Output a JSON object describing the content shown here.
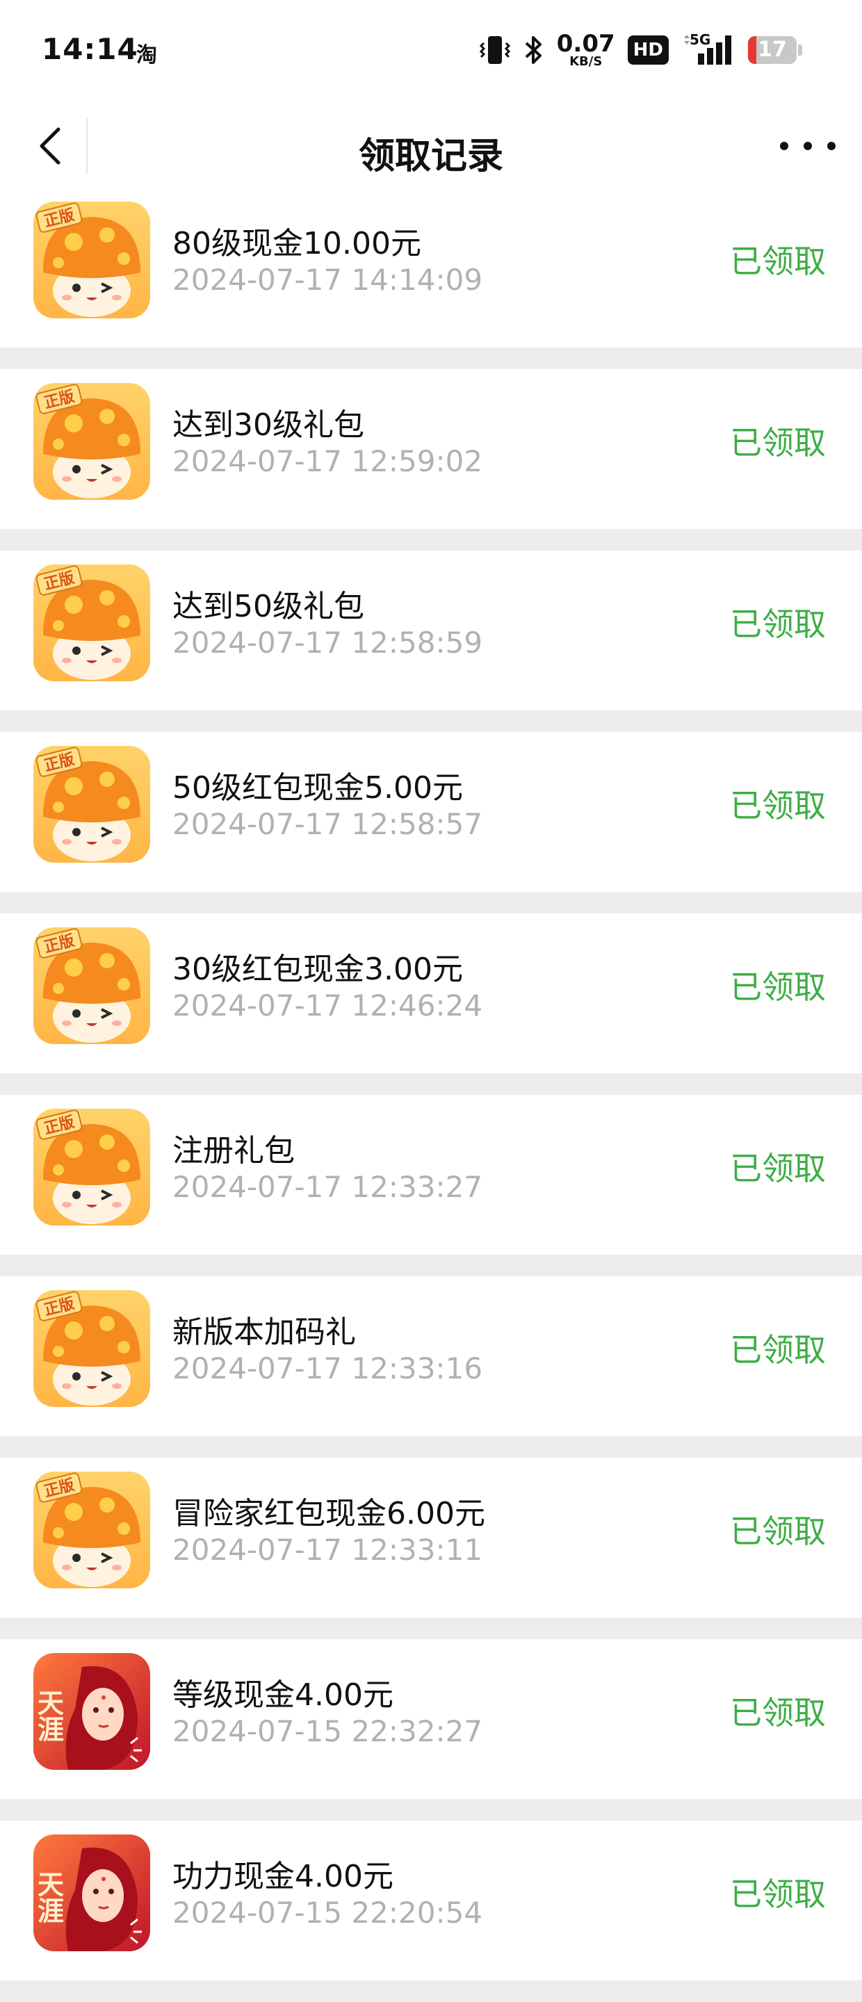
{
  "status_bar": {
    "time": "14:14",
    "app_glyph": "淘",
    "network_speed": "0.07",
    "network_unit": "KB/S",
    "hd_label": "HD",
    "signal_label": "5G",
    "battery_level": 17,
    "battery_text": "17",
    "icons": [
      "vibrate-icon",
      "bluetooth-icon",
      "signal-icon",
      "battery-icon"
    ]
  },
  "nav": {
    "title": "领取记录",
    "back_icon": "chevron-left-icon",
    "more_icon": "more-dots-icon"
  },
  "colors": {
    "status_green": "#3cae45",
    "time_gray": "#b1b1b1",
    "page_bg": "#ededf0"
  },
  "records": [
    {
      "title": "80级现金10.00元",
      "time": "2024-07-17 14:14:09",
      "status": "已领取",
      "icon": "mushroom-game-icon",
      "badge": "正版"
    },
    {
      "title": "达到30级礼包",
      "time": "2024-07-17 12:59:02",
      "status": "已领取",
      "icon": "mushroom-game-icon",
      "badge": "正版"
    },
    {
      "title": "达到50级礼包",
      "time": "2024-07-17 12:58:59",
      "status": "已领取",
      "icon": "mushroom-game-icon",
      "badge": "正版"
    },
    {
      "title": "50级红包现金5.00元",
      "time": "2024-07-17 12:58:57",
      "status": "已领取",
      "icon": "mushroom-game-icon",
      "badge": "正版"
    },
    {
      "title": "30级红包现金3.00元",
      "time": "2024-07-17 12:46:24",
      "status": "已领取",
      "icon": "mushroom-game-icon",
      "badge": "正版"
    },
    {
      "title": "注册礼包",
      "time": "2024-07-17 12:33:27",
      "status": "已领取",
      "icon": "mushroom-game-icon",
      "badge": "正版"
    },
    {
      "title": "新版本加码礼",
      "time": "2024-07-17 12:33:16",
      "status": "已领取",
      "icon": "mushroom-game-icon",
      "badge": "正版"
    },
    {
      "title": "冒险家红包现金6.00元",
      "time": "2024-07-17 12:33:11",
      "status": "已领取",
      "icon": "mushroom-game-icon",
      "badge": "正版"
    },
    {
      "title": "等级现金4.00元",
      "time": "2024-07-15 22:32:27",
      "status": "已领取",
      "icon": "tianya-game-icon",
      "badge": "天涯"
    },
    {
      "title": "功力现金4.00元",
      "time": "2024-07-15 22:20:54",
      "status": "已领取",
      "icon": "tianya-game-icon",
      "badge": "天涯"
    }
  ]
}
